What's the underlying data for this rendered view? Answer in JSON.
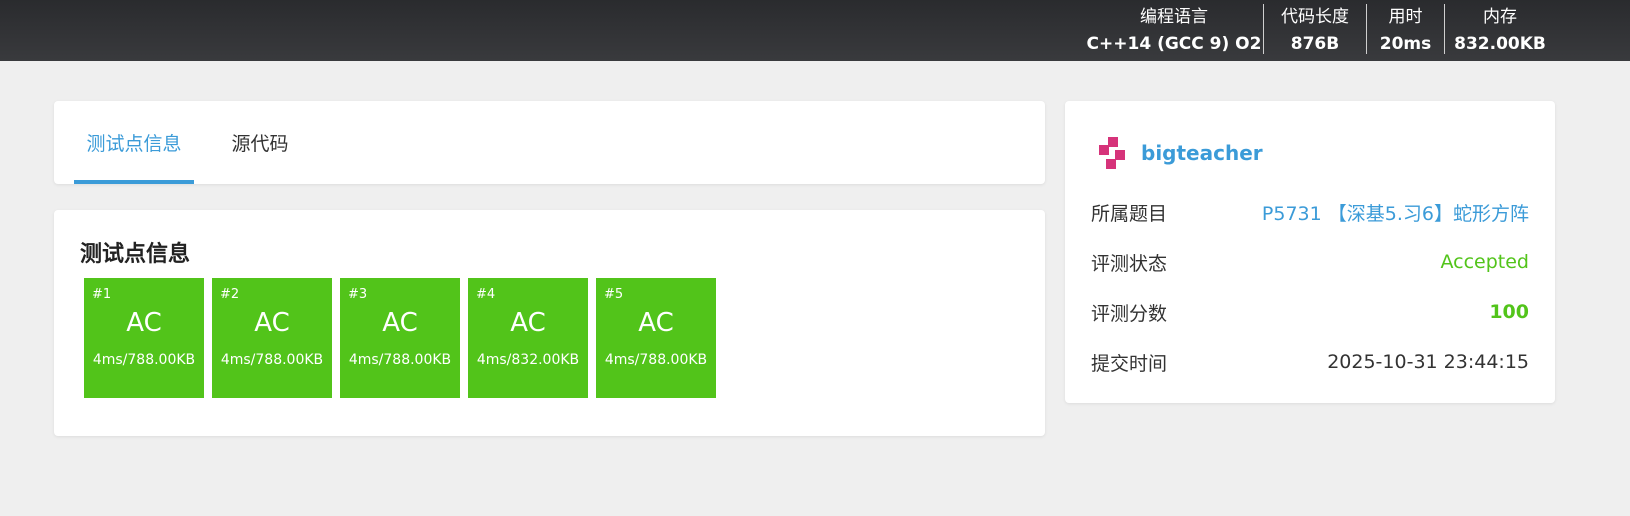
{
  "header": {
    "stats": [
      {
        "label": "编程语言",
        "value": "C++14 (GCC 9) O2"
      },
      {
        "label": "代码长度",
        "value": "876B"
      },
      {
        "label": "用时",
        "value": "20ms"
      },
      {
        "label": "内存",
        "value": "832.00KB"
      }
    ]
  },
  "tabs": [
    {
      "label": "测试点信息",
      "active": true
    },
    {
      "label": "源代码",
      "active": false
    }
  ],
  "tests": {
    "title": "测试点信息",
    "cases": [
      {
        "id": "#1",
        "result": "AC",
        "meta": "4ms/788.00KB"
      },
      {
        "id": "#2",
        "result": "AC",
        "meta": "4ms/788.00KB"
      },
      {
        "id": "#3",
        "result": "AC",
        "meta": "4ms/788.00KB"
      },
      {
        "id": "#4",
        "result": "AC",
        "meta": "4ms/832.00KB"
      },
      {
        "id": "#5",
        "result": "AC",
        "meta": "4ms/788.00KB"
      }
    ],
    "color": "#52c41a"
  },
  "info": {
    "username": "bigteacher",
    "rows": [
      {
        "key": "所属题目",
        "value": "P5731 【深基5.习6】蛇形方阵"
      },
      {
        "key": "评测状态",
        "value": "Accepted"
      },
      {
        "key": "评测分数",
        "value": "100"
      },
      {
        "key": "提交时间",
        "value": "2025-10-31 23:44:15"
      }
    ]
  },
  "colors": {
    "accent": "#3b9bd8",
    "success": "#52c41a",
    "avatar": "#d6337a"
  }
}
